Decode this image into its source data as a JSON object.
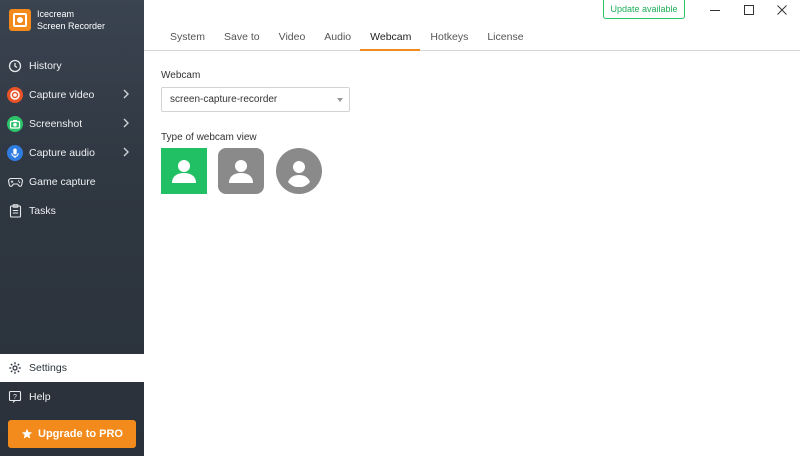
{
  "app": {
    "name_line1": "Icecream",
    "name_line2": "Screen Recorder"
  },
  "sidebar": {
    "items": [
      {
        "label": "History",
        "icon": "clock-icon"
      },
      {
        "label": "Capture video",
        "icon": "record-icon"
      },
      {
        "label": "Screenshot",
        "icon": "camera-icon"
      },
      {
        "label": "Capture audio",
        "icon": "microphone-icon"
      },
      {
        "label": "Game capture",
        "icon": "gamepad-icon"
      },
      {
        "label": "Tasks",
        "icon": "tasks-icon"
      }
    ],
    "settings_label": "Settings",
    "help_label": "Help",
    "upgrade_label": "Upgrade to PRO"
  },
  "header": {
    "update_label": "Update available"
  },
  "tabs": [
    {
      "label": "System"
    },
    {
      "label": "Save to"
    },
    {
      "label": "Video"
    },
    {
      "label": "Audio"
    },
    {
      "label": "Webcam",
      "active": true
    },
    {
      "label": "Hotkeys"
    },
    {
      "label": "License"
    }
  ],
  "webcam": {
    "label": "Webcam",
    "selected": "screen-capture-recorder",
    "view_label": "Type of webcam view",
    "views": [
      {
        "shape": "square",
        "selected": true
      },
      {
        "shape": "rounded",
        "selected": false
      },
      {
        "shape": "circle",
        "selected": false
      }
    ]
  },
  "colors": {
    "accent": "#f28a1c",
    "selected_view": "#22c064",
    "unselected_view": "#8a8a8a",
    "update": "#1fae59"
  }
}
